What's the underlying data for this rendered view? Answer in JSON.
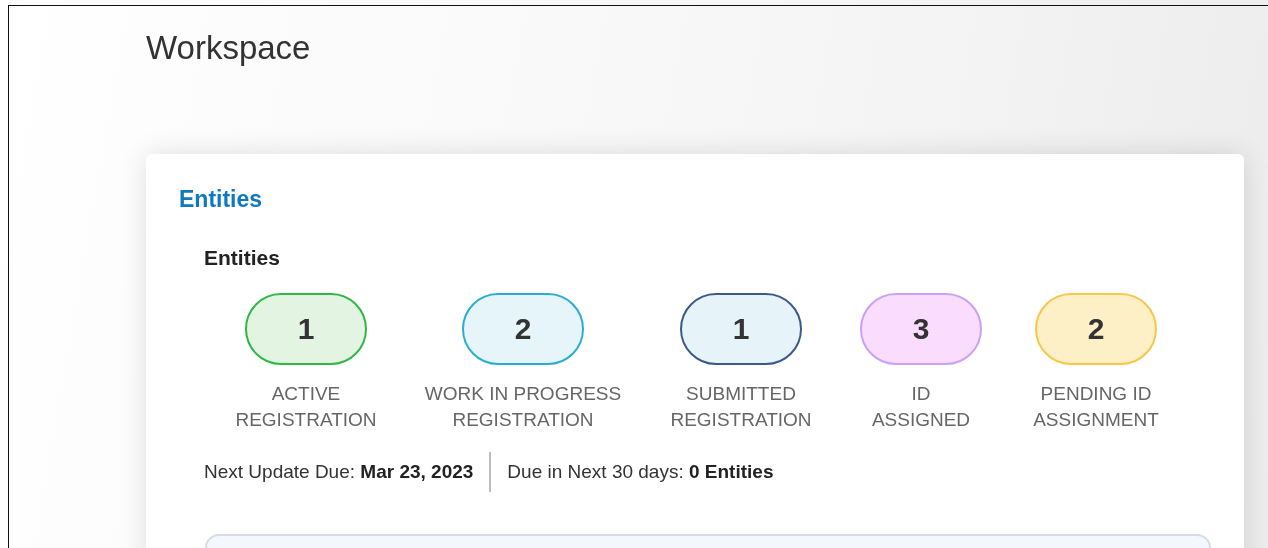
{
  "page": {
    "title": "Workspace"
  },
  "card": {
    "title": "Entities",
    "section_title": "Entities",
    "statuses": [
      {
        "count": "1",
        "label": "ACTIVE\nREGISTRATION",
        "color": "#2fb844"
      },
      {
        "count": "2",
        "label": "WORK IN PROGRESS\nREGISTRATION",
        "color": "#2aaed0"
      },
      {
        "count": "1",
        "label": "SUBMITTED\nREGISTRATION",
        "color": "#3b5a8a"
      },
      {
        "count": "3",
        "label": "ID\nASSIGNED",
        "color": "#c8a2f7"
      },
      {
        "count": "2",
        "label": "PENDING ID\nASSIGNMENT",
        "color": "#f5c84a"
      }
    ],
    "summary": [
      "Next Update Due: **Mar 23, 2023**",
      "Due in Next 30 days: **0 Entities**"
    ]
  }
}
